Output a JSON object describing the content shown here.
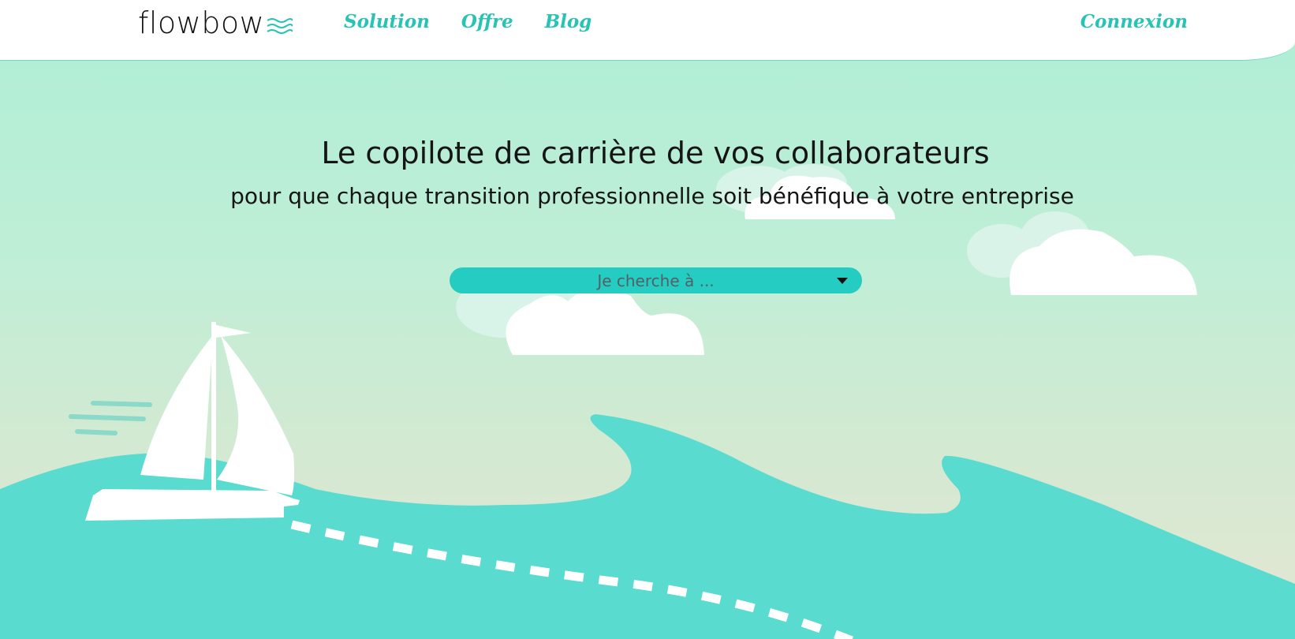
{
  "header": {
    "logo_text": "flowbow",
    "nav": [
      "Solution",
      "Offre",
      "Blog"
    ],
    "login": "Connexion"
  },
  "hero": {
    "title": "Le copilote de carrière de vos collaborateurs",
    "subtitle": "pour que chaque transition professionnelle soit bénéfique à votre entreprise",
    "select_placeholder": "Je cherche à ..."
  },
  "colors": {
    "accent": "#27c3b3",
    "select_bg": "#24ccc2",
    "sea": "#59dbcf",
    "sky_top": "#aeeed6",
    "sky_bottom": "#e4e6d3"
  },
  "icons": {
    "logo_mark": "waves-icon",
    "dropdown": "caret-down-icon"
  }
}
